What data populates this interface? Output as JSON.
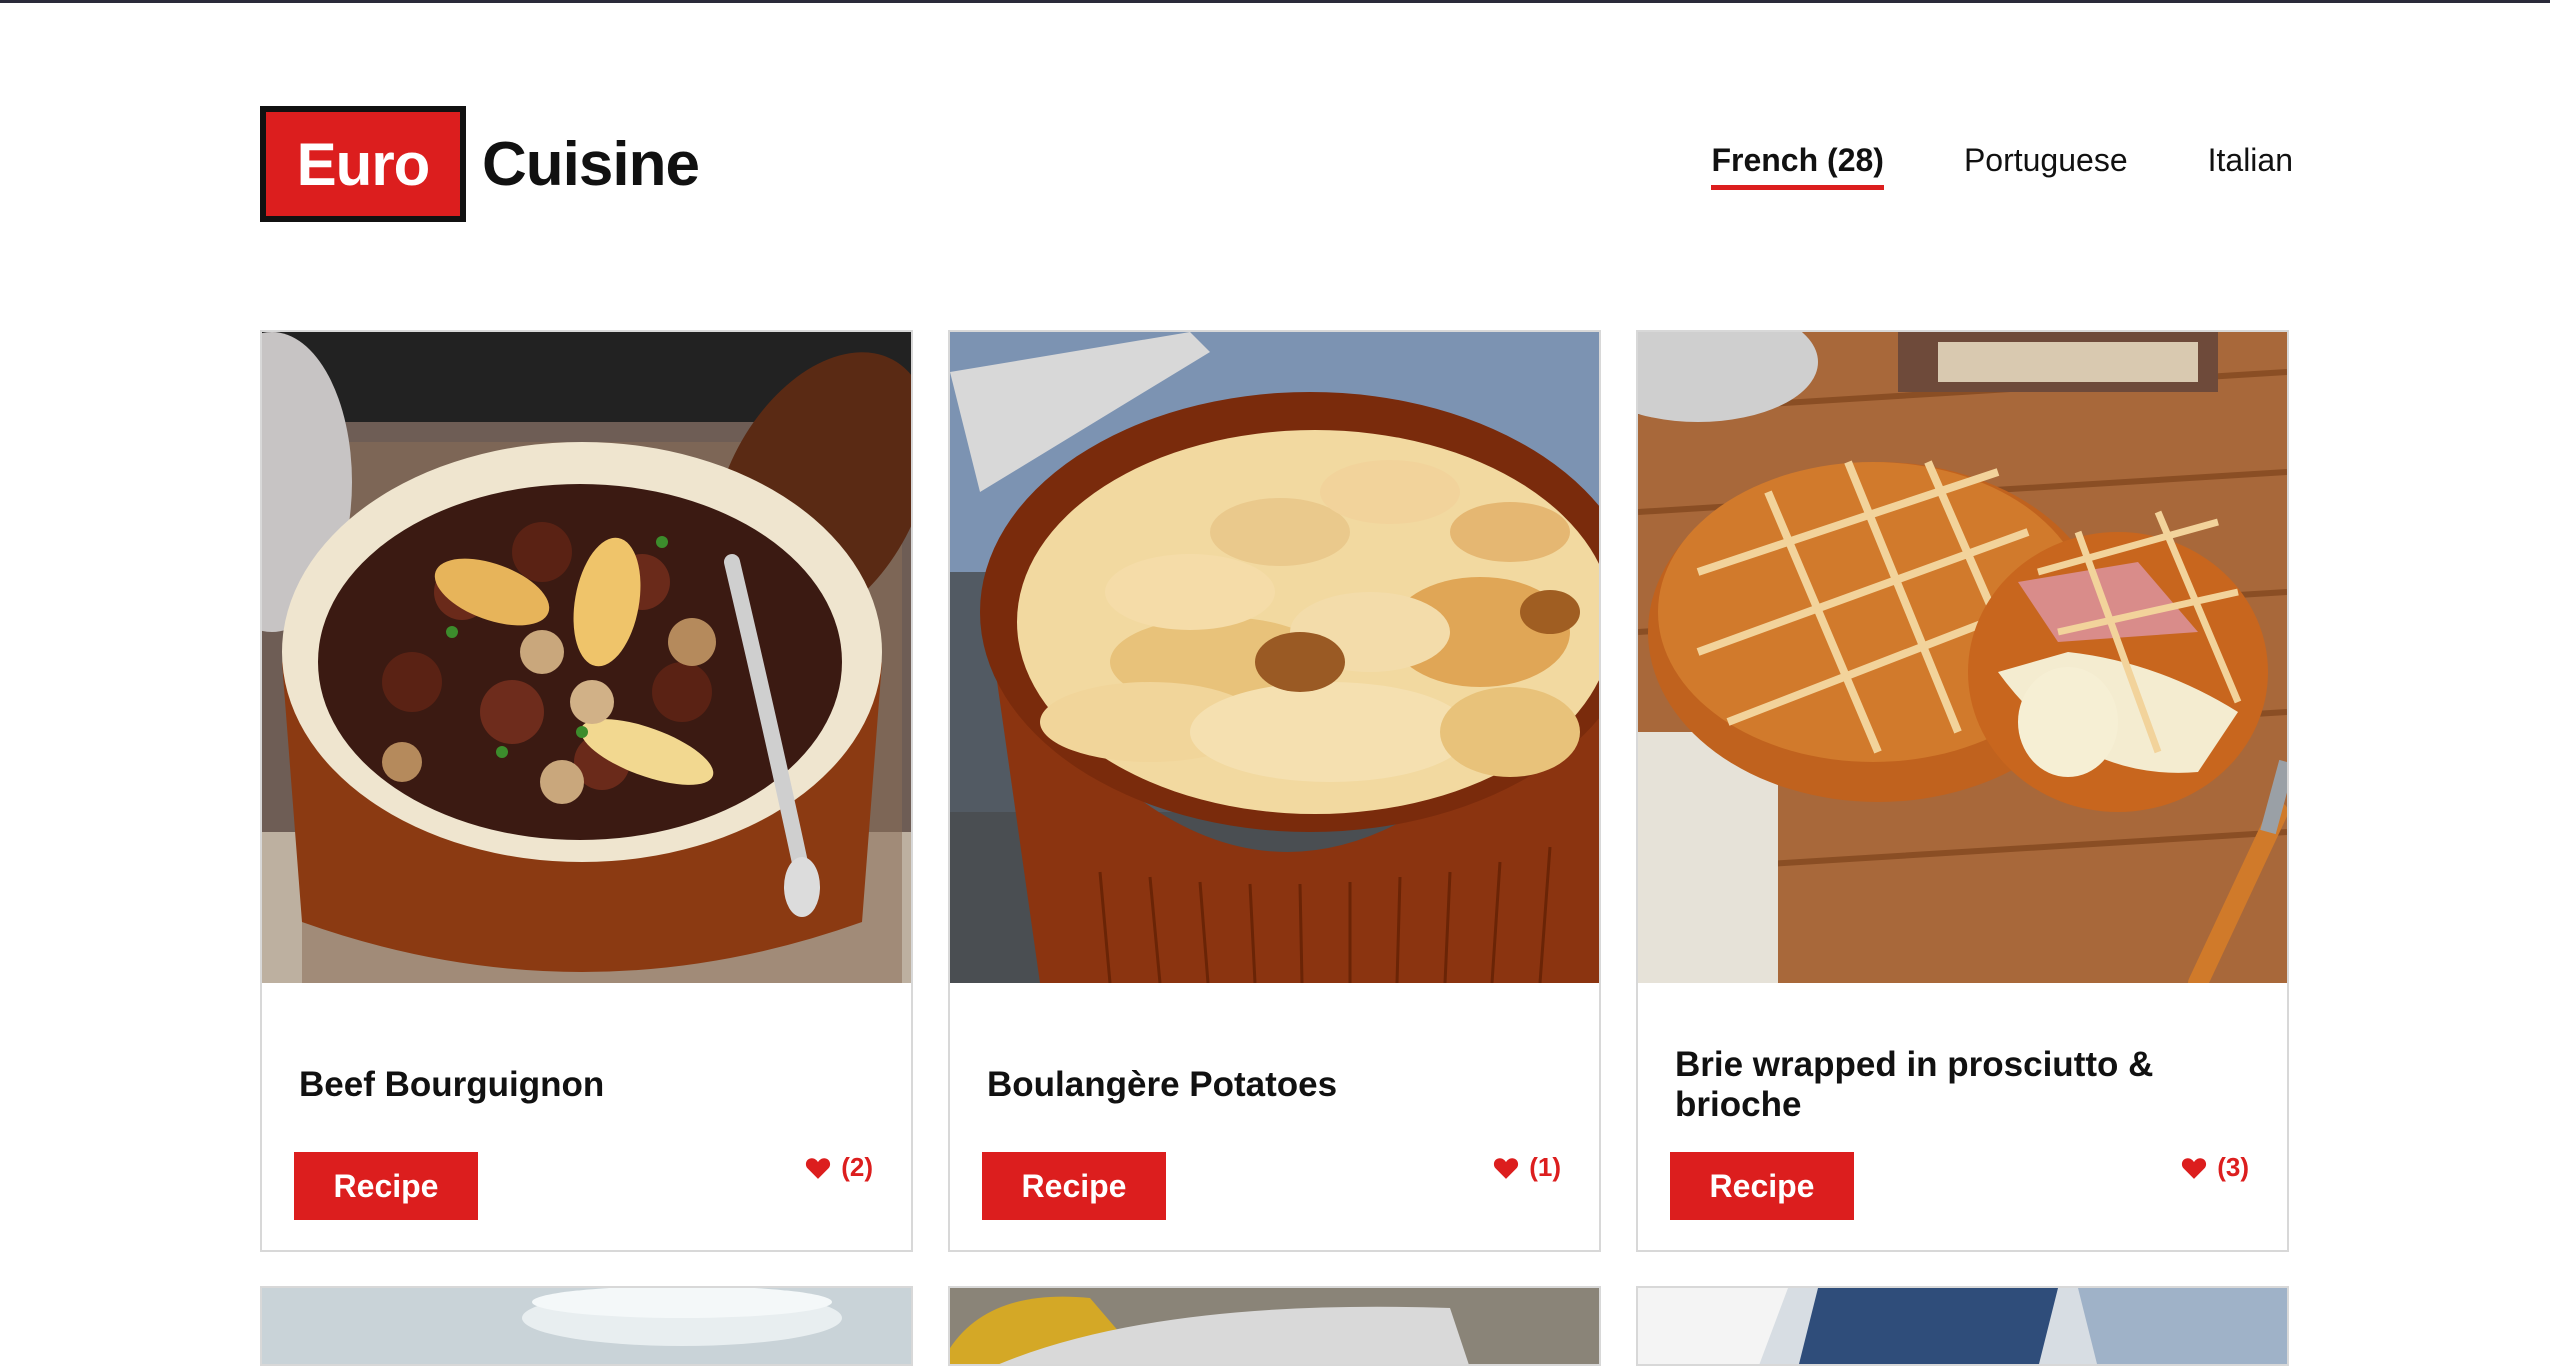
{
  "brand": {
    "logo_box_text": "Euro",
    "logo_word": "Cuisine",
    "colors": {
      "accent": "#dc1e1e",
      "text": "#111111",
      "border": "#d8d8d8"
    }
  },
  "nav": {
    "items": [
      {
        "label": "French (28)",
        "active": true
      },
      {
        "label": "Portuguese",
        "active": false
      },
      {
        "label": "Italian",
        "active": false
      }
    ]
  },
  "recipes": [
    {
      "title": "Beef Bourguignon",
      "button_label": "Recipe",
      "likes": "(2)",
      "icon": "heart-icon"
    },
    {
      "title": "Boulangère Potatoes",
      "button_label": "Recipe",
      "likes": "(1)",
      "icon": "heart-icon"
    },
    {
      "title": "Brie wrapped in prosciutto & brioche",
      "button_label": "Recipe",
      "likes": "(3)",
      "icon": "heart-icon"
    }
  ]
}
